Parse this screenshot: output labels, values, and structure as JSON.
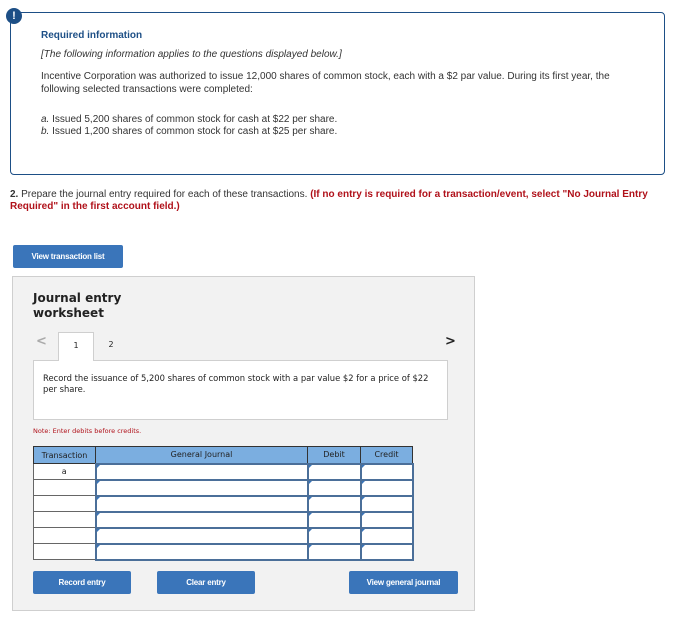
{
  "alert": {
    "icon": "exclamation-icon",
    "glyph": "!"
  },
  "info": {
    "title": "Required information",
    "italic_note": "[The following information applies to the questions displayed below.]",
    "paragraph": "Incentive Corporation was authorized to issue 12,000 shares of common stock, each with a $2 par value. During its first year, the following selected transactions were completed:",
    "items": [
      {
        "letter": "a.",
        "text": " Issued 5,200 shares of common stock for cash at $22 per share."
      },
      {
        "letter": "b.",
        "text": " Issued 1,200 shares of common stock for cash at $25 per share."
      }
    ]
  },
  "question": {
    "number": "2.",
    "text": " Prepare the journal entry required for each of these transactions. ",
    "instruction": "(If no entry is required for a transaction/event, select \"No Journal Entry Required\" in the first account field.)"
  },
  "buttons": {
    "view_transaction_list": "View transaction list",
    "record_entry": "Record entry",
    "clear_entry": "Clear entry",
    "view_general_journal": "View general journal"
  },
  "worksheet": {
    "title_line1": "Journal entry",
    "title_line2": "worksheet",
    "prev_glyph": "<",
    "next_glyph": ">",
    "tabs": [
      {
        "label": "1",
        "active": true
      },
      {
        "label": "2",
        "active": false
      }
    ],
    "description": "Record the issuance of 5,200 shares of common stock with a par value $2 for a price of $22 per share.",
    "note": "Note: Enter debits before credits.",
    "table": {
      "headers": [
        "Transaction",
        "General Journal",
        "Debit",
        "Credit"
      ],
      "rows": [
        {
          "transaction": "a",
          "account": "",
          "debit": "",
          "credit": ""
        },
        {
          "transaction": "",
          "account": "",
          "debit": "",
          "credit": ""
        },
        {
          "transaction": "",
          "account": "",
          "debit": "",
          "credit": ""
        },
        {
          "transaction": "",
          "account": "",
          "debit": "",
          "credit": ""
        },
        {
          "transaction": "",
          "account": "",
          "debit": "",
          "credit": ""
        },
        {
          "transaction": "",
          "account": "",
          "debit": "",
          "credit": ""
        }
      ]
    }
  }
}
